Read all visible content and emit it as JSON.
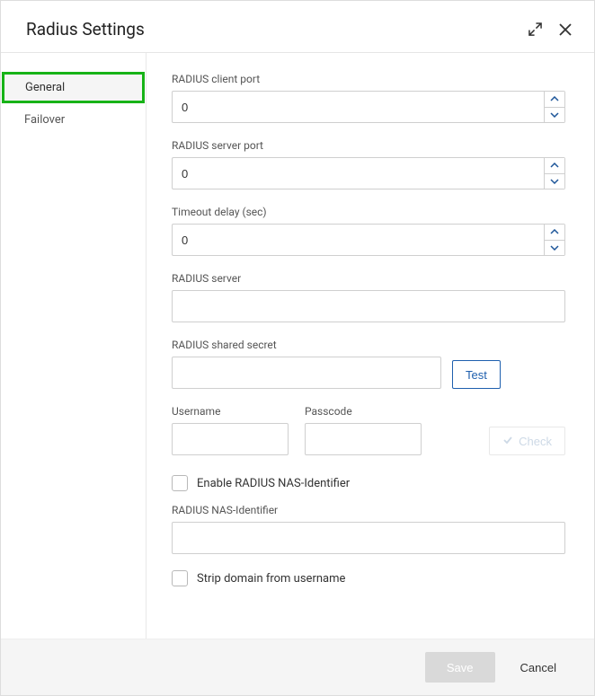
{
  "dialog": {
    "title": "Radius Settings"
  },
  "tabs": {
    "general": "General",
    "failover": "Failover"
  },
  "fields": {
    "client_port_label": "RADIUS client port",
    "client_port_value": "0",
    "server_port_label": "RADIUS server port",
    "server_port_value": "0",
    "timeout_label": "Timeout delay (sec)",
    "timeout_value": "0",
    "server_label": "RADIUS server",
    "server_value": "",
    "secret_label": "RADIUS shared secret",
    "secret_value": "",
    "test_btn": "Test",
    "username_label": "Username",
    "username_value": "",
    "passcode_label": "Passcode",
    "passcode_value": "",
    "check_btn": "Check",
    "enable_nas_label": "Enable RADIUS NAS-Identifier",
    "nas_id_label": "RADIUS NAS-Identifier",
    "nas_id_value": "",
    "strip_domain_label": "Strip domain from username"
  },
  "footer": {
    "save": "Save",
    "cancel": "Cancel"
  }
}
